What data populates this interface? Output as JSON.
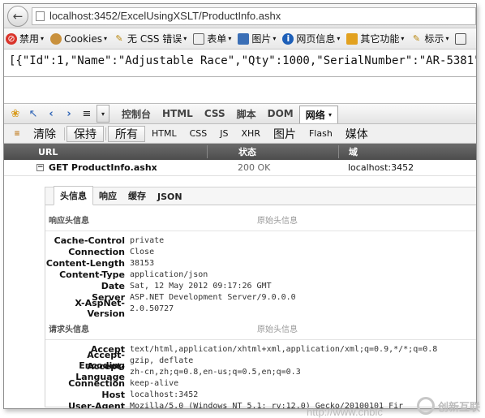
{
  "address_bar": {
    "url": "localhost:3452/ExcelUsingXSLT/ProductInfo.ashx"
  },
  "webdev_toolbar": {
    "items": [
      {
        "label": "禁用",
        "icon": "disable-icon"
      },
      {
        "label": "Cookies",
        "icon": "cookie-icon"
      },
      {
        "label": "无 CSS 错误",
        "icon": "css-icon"
      },
      {
        "label": "表单",
        "icon": "form-icon"
      },
      {
        "label": "图片",
        "icon": "image-icon"
      },
      {
        "label": "网页信息",
        "icon": "info-icon"
      },
      {
        "label": "其它功能",
        "icon": "misc-icon"
      },
      {
        "label": "标示",
        "icon": "outline-icon"
      }
    ]
  },
  "page": {
    "content": "[{\"Id\":1,\"Name\":\"Adjustable Race\",\"Qty\":1000,\"SerialNumber\":\"AR-5381\"},"
  },
  "firebug": {
    "tabs": [
      "控制台",
      "HTML",
      "CSS",
      "脚本",
      "DOM"
    ],
    "active_tab": "网络",
    "net_buttons": [
      "清除",
      "保持",
      "所有",
      "HTML",
      "CSS",
      "JS",
      "XHR",
      "图片",
      "Flash",
      "媒体"
    ],
    "columns": {
      "url": "URL",
      "status": "状态",
      "domain": "域"
    },
    "request": {
      "url": "GET ProductInfo.ashx",
      "status": "200 OK",
      "domain": "localhost:3452"
    },
    "detail_tabs": [
      "头信息",
      "响应",
      "缓存",
      "JSON"
    ],
    "response_headers_title": "响应头信息",
    "request_headers_title": "请求头信息",
    "raw_headers_label": "原始头信息",
    "response_headers": [
      {
        "name": "Cache-Control",
        "value": "private"
      },
      {
        "name": "Connection",
        "value": "Close"
      },
      {
        "name": "Content-Length",
        "value": "38153"
      },
      {
        "name": "Content-Type",
        "value": "application/json"
      },
      {
        "name": "Date",
        "value": "Sat, 12 May 2012 09:17:26 GMT"
      },
      {
        "name": "Server",
        "value": "ASP.NET Development Server/9.0.0.0"
      },
      {
        "name": "X-AspNet-Version",
        "value": "2.0.50727"
      }
    ],
    "request_headers": [
      {
        "name": "Accept",
        "value": "text/html,application/xhtml+xml,application/xml;q=0.9,*/*;q=0.8"
      },
      {
        "name": "Accept-Encoding",
        "value": "gzip, deflate"
      },
      {
        "name": "Accept-Language",
        "value": "zh-cn,zh;q=0.8,en-us;q=0.5,en;q=0.3"
      },
      {
        "name": "Connection",
        "value": "keep-alive"
      },
      {
        "name": "Host",
        "value": "localhost:3452"
      },
      {
        "name": "User-Agent",
        "value": "Mozilla/5.0 (Windows NT 5.1; rv:12.0) Gecko/20100101 Fir"
      }
    ]
  },
  "watermark": {
    "brand": "创新互联",
    "url": "http://www.cnblc"
  }
}
